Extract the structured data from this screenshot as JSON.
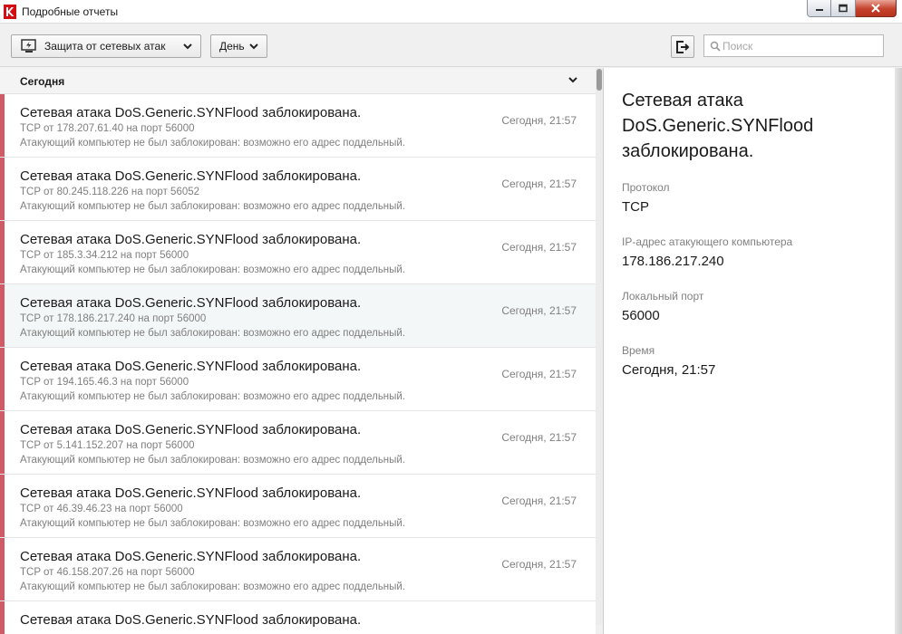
{
  "window": {
    "title": "Подробные отчеты"
  },
  "toolbar": {
    "scope_dropdown": "Защита от сетевых атак",
    "period_dropdown": "День",
    "search_placeholder": "Поиск"
  },
  "list": {
    "group_title": "Сегодня",
    "rows": [
      {
        "title": "Сетевая атака DoS.Generic.SYNFlood заблокирована.",
        "subtitle": "TCP от 178.207.61.40 на порт 56000",
        "description": "Атакующий компьютер не был заблокирован: возможно его адрес поддельный.",
        "time": "Сегодня, 21:57"
      },
      {
        "title": "Сетевая атака DoS.Generic.SYNFlood заблокирована.",
        "subtitle": "TCP от 80.245.118.226 на порт 56052",
        "description": "Атакующий компьютер не был заблокирован: возможно его адрес поддельный.",
        "time": "Сегодня, 21:57"
      },
      {
        "title": "Сетевая атака DoS.Generic.SYNFlood заблокирована.",
        "subtitle": "TCP от 185.3.34.212 на порт 56000",
        "description": "Атакующий компьютер не был заблокирован: возможно его адрес поддельный.",
        "time": "Сегодня, 21:57"
      },
      {
        "title": "Сетевая атака DoS.Generic.SYNFlood заблокирована.",
        "subtitle": "TCP от 178.186.217.240 на порт 56000",
        "description": "Атакующий компьютер не был заблокирован: возможно его адрес поддельный.",
        "time": "Сегодня, 21:57"
      },
      {
        "title": "Сетевая атака DoS.Generic.SYNFlood заблокирована.",
        "subtitle": "TCP от 194.165.46.3 на порт 56000",
        "description": "Атакующий компьютер не был заблокирован: возможно его адрес поддельный.",
        "time": "Сегодня, 21:57"
      },
      {
        "title": "Сетевая атака DoS.Generic.SYNFlood заблокирована.",
        "subtitle": "TCP от 5.141.152.207 на порт 56000",
        "description": "Атакующий компьютер не был заблокирован: возможно его адрес поддельный.",
        "time": "Сегодня, 21:57"
      },
      {
        "title": "Сетевая атака DoS.Generic.SYNFlood заблокирована.",
        "subtitle": "TCP от 46.39.46.23 на порт 56000",
        "description": "Атакующий компьютер не был заблокирован: возможно его адрес поддельный.",
        "time": "Сегодня, 21:57"
      },
      {
        "title": "Сетевая атака DoS.Generic.SYNFlood заблокирована.",
        "subtitle": "TCP от 46.158.207.26 на порт 56000",
        "description": "Атакующий компьютер не был заблокирован: возможно его адрес поддельный.",
        "time": "Сегодня, 21:57"
      },
      {
        "title": "Сетевая атака DoS.Generic.SYNFlood заблокирована.",
        "subtitle": "",
        "description": "",
        "time": ""
      }
    ]
  },
  "details": {
    "title": "Сетевая атака DoS.Generic.SYNFlood заблокирована.",
    "protocol_label": "Протокол",
    "protocol_value": "TCP",
    "ip_label": "IP-адрес атакующего компьютера",
    "ip_value": "178.186.217.240",
    "port_label": "Локальный порт",
    "port_value": "56000",
    "time_label": "Время",
    "time_value": "Сегодня, 21:57"
  },
  "icons": {
    "app": "kaspersky-logo-icon",
    "minimize": "minimize-icon",
    "maximize": "maximize-icon",
    "close": "close-icon",
    "scope": "network-monitor-icon",
    "export": "export-icon",
    "search": "search-icon",
    "collapse": "chevron-down-icon"
  },
  "colors": {
    "alert_stripe": "#d05a66",
    "close_button": "#c4412b",
    "selected_row": "#f4f7f7"
  }
}
